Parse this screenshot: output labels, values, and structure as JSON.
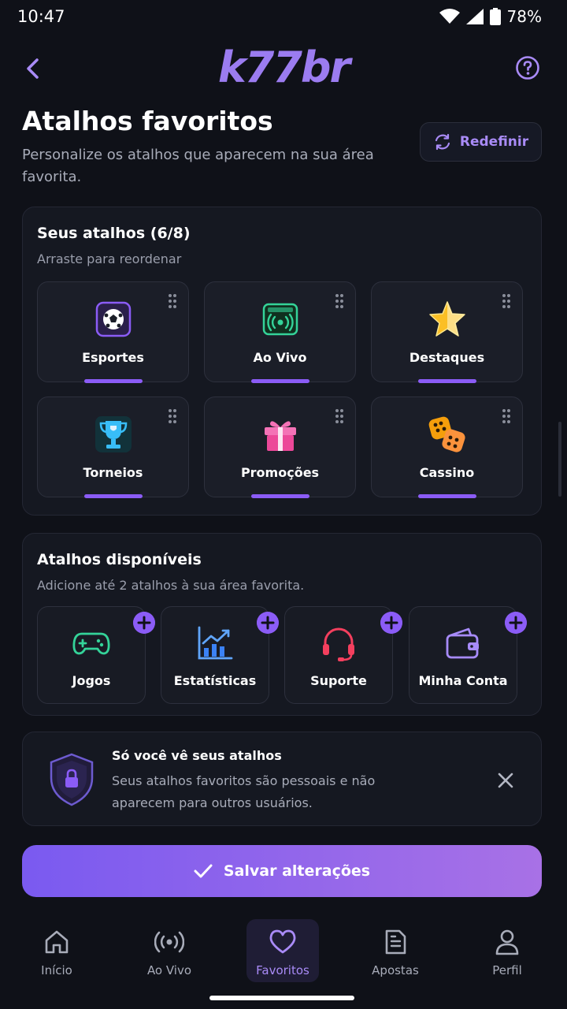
{
  "status": {
    "time": "10:47",
    "battery": "78%"
  },
  "appbar": {
    "logo": "k77br"
  },
  "header": {
    "title": "Atalhos favoritos",
    "subtitle": "Personalize os atalhos que aparecem na sua área favorita.",
    "reset_label": "Redefinir"
  },
  "my_shortcuts": {
    "title": "Seus atalhos (6/8)",
    "hint": "Arraste para reordenar",
    "items": [
      {
        "label": "Esportes",
        "icon": "soccer-ball-icon"
      },
      {
        "label": "Ao Vivo",
        "icon": "live-broadcast-icon"
      },
      {
        "label": "Destaques",
        "icon": "star-icon"
      },
      {
        "label": "Torneios",
        "icon": "trophy-icon"
      },
      {
        "label": "Promoções",
        "icon": "gift-icon"
      },
      {
        "label": "Cassino",
        "icon": "dice-icon"
      }
    ]
  },
  "available": {
    "title": "Atalhos disponíveis",
    "hint": "Adicione até 2 atalhos à sua área favorita.",
    "items": [
      {
        "label": "Jogos",
        "icon": "gamepad-icon"
      },
      {
        "label": "Estatísticas",
        "icon": "stats-chart-icon"
      },
      {
        "label": "Suporte",
        "icon": "headset-icon"
      },
      {
        "label": "Minha Conta",
        "icon": "wallet-icon"
      }
    ]
  },
  "notice": {
    "title": "Só você vê seus atalhos",
    "text": "Seus atalhos favoritos são pessoais e não aparecem para outros usuários."
  },
  "save_label": "Salvar alterações",
  "nav": [
    {
      "label": "Início",
      "icon": "home-icon"
    },
    {
      "label": "Ao Vivo",
      "icon": "live-icon"
    },
    {
      "label": "Favoritos",
      "icon": "heart-icon",
      "active": true
    },
    {
      "label": "Apostas",
      "icon": "ticket-icon"
    },
    {
      "label": "Perfil",
      "icon": "user-icon"
    }
  ],
  "colors": {
    "accent": "#8b5cf6",
    "background": "#0f1118",
    "card": "#151821"
  }
}
